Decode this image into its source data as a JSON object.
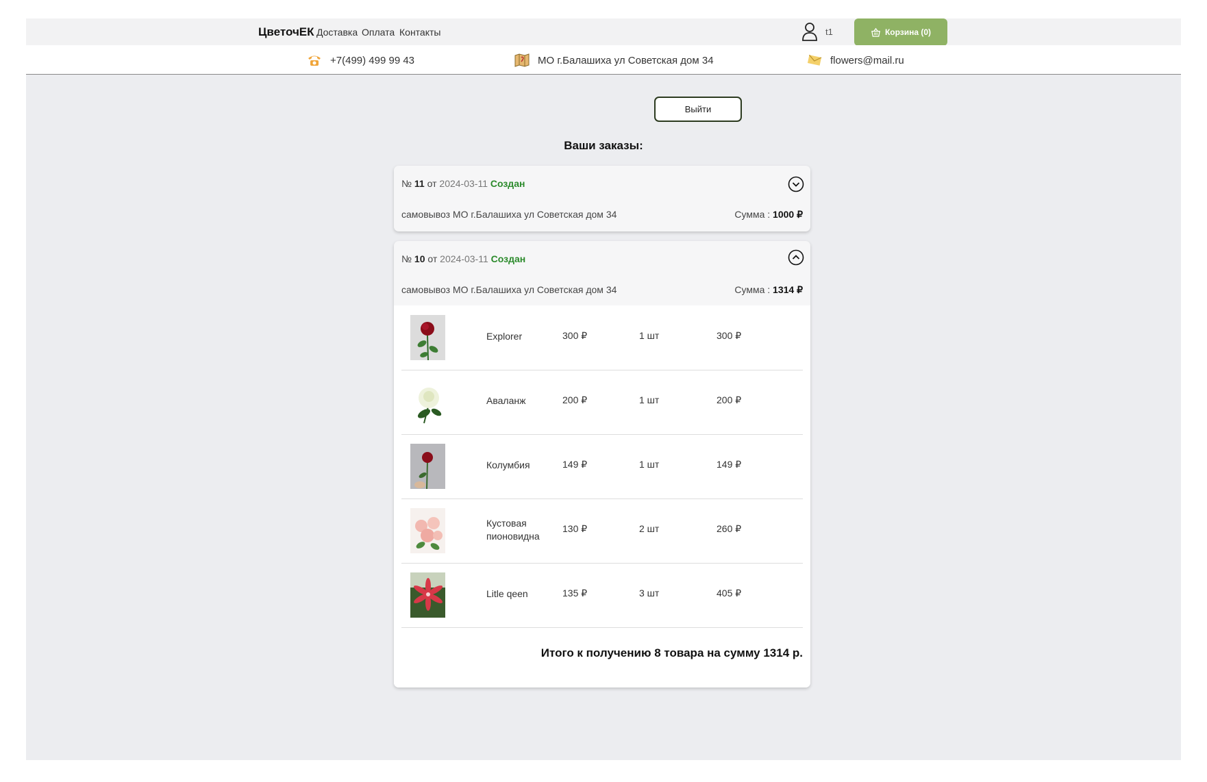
{
  "header": {
    "brand": "ЦветочЕК",
    "nav": [
      "Доставка",
      "Оплата",
      "Контакты"
    ],
    "user": "t1",
    "cart_label": "Корзина (0)",
    "icons": {
      "user": "user-icon",
      "cart": "basket-icon"
    }
  },
  "contacts": {
    "phone": "+7(499) 499 99 43",
    "address": "МО г.Балашиха ул Советская дом 34",
    "email": "flowers@mail.ru"
  },
  "page": {
    "logout_label": "Выйти",
    "orders_title": "Ваши заказы:"
  },
  "orders": [
    {
      "number_prefix": "№",
      "number": "11",
      "from": "от",
      "date": "2024-03-11",
      "status": "Создан",
      "delivery": "самовывоз",
      "address": "МО г.Балашиха ул Советская дом 34",
      "sum_label": "Сумма :",
      "sum": "1000 ₽",
      "expanded": false
    },
    {
      "number_prefix": "№",
      "number": "10",
      "from": "от",
      "date": "2024-03-11",
      "status": "Создан",
      "delivery": "самовывоз",
      "address": "МО г.Балашиха ул Советская дом 34",
      "sum_label": "Сумма :",
      "sum": "1314 ₽",
      "expanded": true,
      "items": [
        {
          "name": "Explorer",
          "price": "300 ₽",
          "qty": "1 шт",
          "total": "300 ₽"
        },
        {
          "name": "Аваланж",
          "price": "200 ₽",
          "qty": "1 шт",
          "total": "200 ₽"
        },
        {
          "name": "Колумбия",
          "price": "149 ₽",
          "qty": "1 шт",
          "total": "149 ₽"
        },
        {
          "name": "Кустовая пионовидна",
          "price": "130 ₽",
          "qty": "2 шт",
          "total": "260 ₽"
        },
        {
          "name": "Litle qeen",
          "price": "135 ₽",
          "qty": "3 шт",
          "total": "405 ₽"
        }
      ],
      "summary": "Итого к получению 8 товара на сумму 1314 р."
    }
  ],
  "colors": {
    "accent": "#8fb264",
    "status": "#2b8a2b",
    "background": "#ecedf0"
  }
}
